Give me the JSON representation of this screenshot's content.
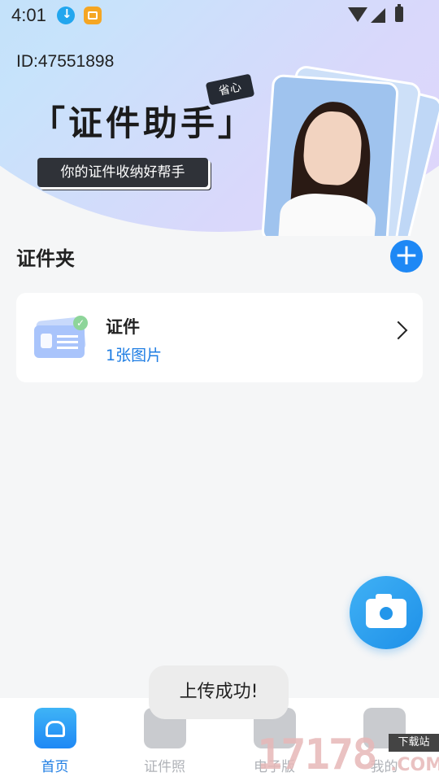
{
  "status_bar": {
    "time": "4:01"
  },
  "header": {
    "user_id": "ID:47551898",
    "brand_title": "「证件助手」",
    "tag": "省心",
    "slogan": "你的证件收纳好帮手"
  },
  "section": {
    "title": "证件夹"
  },
  "folder": {
    "name": "证件",
    "count": "1张图片"
  },
  "toast": "上传成功!",
  "nav": [
    {
      "label": "首页",
      "active": true
    },
    {
      "label": "证件照",
      "active": false
    },
    {
      "label": "电子版",
      "active": false
    },
    {
      "label": "我的",
      "active": false
    }
  ],
  "watermark": {
    "number": "17178",
    "tag": "下载站",
    "suffix": ".COM"
  },
  "colors": {
    "accent": "#1e88f5",
    "link": "#1e7de3"
  }
}
